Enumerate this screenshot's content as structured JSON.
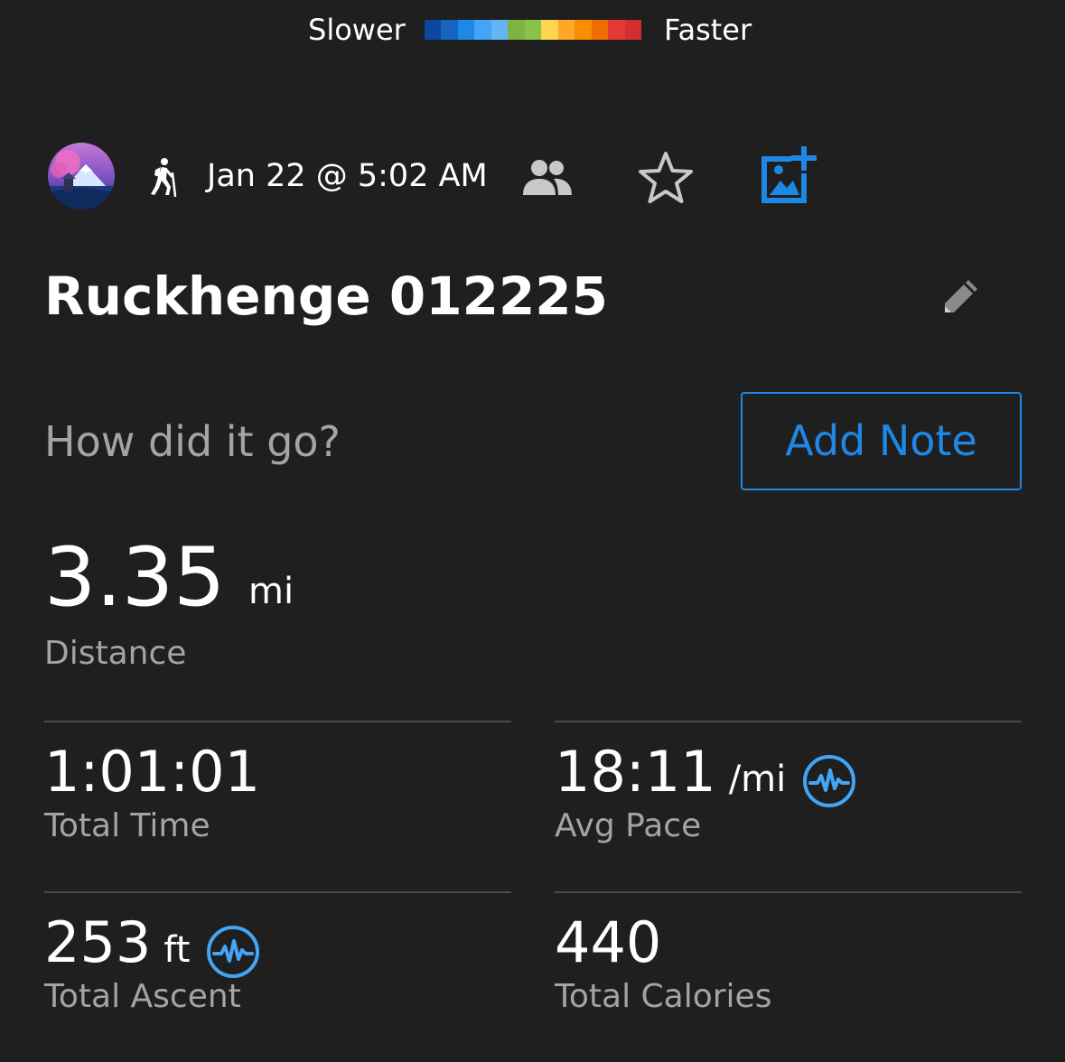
{
  "pace_legend": {
    "slower_label": "Slower",
    "faster_label": "Faster",
    "colors": [
      "#0d47a1",
      "#1565c0",
      "#1e88e5",
      "#42a5f5",
      "#64b5f6",
      "#7cb342",
      "#8bc34a",
      "#ffd54f",
      "#ffa726",
      "#fb8c00",
      "#ef6c00",
      "#e53935",
      "#d32f2f"
    ]
  },
  "header": {
    "activity_type_icon": "hiking-icon",
    "date_time": "Jan 22 @ 5:02 AM",
    "icons": [
      "people-icon",
      "star-icon",
      "add-photo-icon"
    ]
  },
  "activity": {
    "title": "Ruckhenge 012225",
    "edit_icon": "pencil-icon"
  },
  "note": {
    "prompt": "How did it go?",
    "button_label": "Add Note"
  },
  "distance": {
    "value": "3.35",
    "unit": "mi",
    "label": "Distance"
  },
  "stats": {
    "total_time": {
      "value": "1:01:01",
      "unit": "",
      "label": "Total Time"
    },
    "avg_pace": {
      "value": "18:11",
      "unit": "/mi",
      "label": "Avg Pace"
    },
    "total_ascent": {
      "value": "253",
      "unit": "ft",
      "label": "Total Ascent"
    },
    "total_calories": {
      "value": "440",
      "unit": "",
      "label": "Total Calories"
    }
  },
  "colors": {
    "background": "#1f1f1f",
    "accent_blue": "#1e88e5",
    "chart_icon_blue": "#42a5f5",
    "secondary_text": "#a4a4a4",
    "divider": "#4a4a4a"
  }
}
